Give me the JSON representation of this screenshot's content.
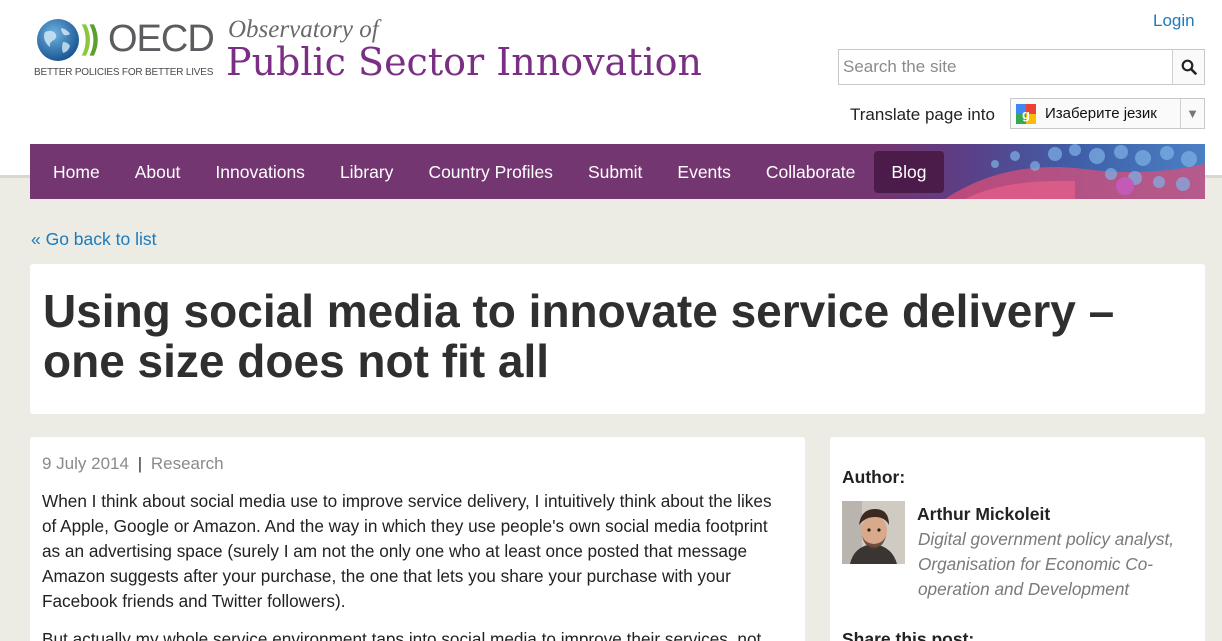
{
  "header": {
    "oecd_word": "OECD",
    "oecd_tagline": "BETTER POLICIES FOR BETTER LIVES",
    "site_title_line1": "Observatory of",
    "site_title_line2": "Public Sector Innovation",
    "login_label": "Login",
    "search": {
      "placeholder": "Search the site",
      "icon": "search-icon"
    },
    "translate": {
      "label": "Translate page into",
      "selected_language": "Изаберите језик",
      "icon": "google-translate-icon"
    }
  },
  "nav": {
    "items": [
      {
        "label": "Home"
      },
      {
        "label": "About"
      },
      {
        "label": "Innovations"
      },
      {
        "label": "Library"
      },
      {
        "label": "Country Profiles"
      },
      {
        "label": "Submit"
      },
      {
        "label": "Events"
      },
      {
        "label": "Collaborate"
      },
      {
        "label": "Blog",
        "active": true
      }
    ]
  },
  "back_link": "« Go back to list",
  "article": {
    "title": "Using social media to innovate service delivery – one size does not fit all",
    "date": "9 July 2014",
    "separator": "|",
    "category": "Research",
    "paragraphs": [
      "When I think about social media use to improve service delivery, I intuitively think about the likes of Apple, Google or Amazon. And the way in which they use people's own social media footprint as an advertising space (surely I am not the only one who at least once posted that message Amazon suggests after your purchase, the one that lets you share your purchase with your Facebook friends and Twitter followers).",
      "But actually my whole service environment taps into social media to improve their services, not"
    ]
  },
  "sidebar": {
    "author_label": "Author:",
    "author_name": "Arthur Mickoleit",
    "author_role": "Digital government policy analyst, Organisation for Economic Co-operation and Development",
    "share_label": "Share this post:"
  },
  "colors": {
    "page_background": "#ecebe4",
    "nav_background": "#733670",
    "nav_active": "#4b1b4a",
    "link": "#1a7bbd",
    "brand_purple": "#7a2f85"
  }
}
